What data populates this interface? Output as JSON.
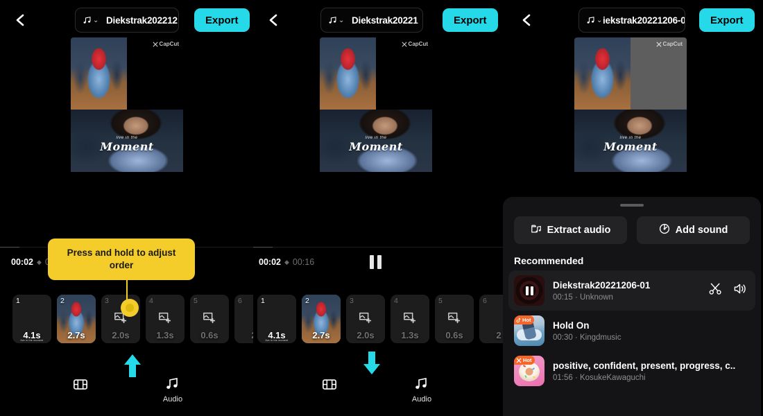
{
  "panes": [
    {
      "back_icon": "chevron-left-icon",
      "title": "Diekstrak202212",
      "music_icon": "music-note-icon",
      "export_label": "Export",
      "watermark": "CapCut",
      "overlay_text_small": "live in the",
      "overlay_text_big": "Moment",
      "time_current": "00:02",
      "time_total": "0",
      "nav": [
        {
          "label": "",
          "icon": "film-strip-icon",
          "selected": true
        },
        {
          "label": "Audio",
          "icon": "music-notes-icon",
          "selected": false
        }
      ],
      "clips": [
        {
          "num": "1",
          "duration": "4.1s",
          "kind": "thumb-girl",
          "selected": false,
          "caption": "live in the moment"
        },
        {
          "num": "2",
          "duration": "2.7s",
          "kind": "thumb-dance",
          "selected": true,
          "caption": ""
        },
        {
          "num": "3",
          "duration": "2.0s",
          "kind": "empty",
          "selected": false,
          "caption": ""
        },
        {
          "num": "4",
          "duration": "1.3s",
          "kind": "empty",
          "selected": false,
          "caption": ""
        },
        {
          "num": "5",
          "duration": "0.6s",
          "kind": "empty",
          "selected": false,
          "caption": ""
        },
        {
          "num": "6",
          "duration": "2",
          "kind": "empty",
          "selected": false,
          "caption": ""
        }
      ]
    },
    {
      "back_icon": "chevron-left-icon",
      "title": "Diekstrak20221",
      "music_icon": "music-note-icon",
      "export_label": "Export",
      "watermark": "CapCut",
      "overlay_text_small": "live in the",
      "overlay_text_big": "Moment",
      "time_current": "00:02",
      "time_total": "00:16",
      "pause_icon": "pause-icon",
      "nav": [
        {
          "label": "",
          "icon": "film-strip-icon",
          "selected": true
        },
        {
          "label": "Audio",
          "icon": "music-notes-icon",
          "selected": false
        }
      ],
      "clips": [
        {
          "num": "1",
          "duration": "4.1s",
          "kind": "thumb-girl",
          "selected": false,
          "caption": "live in the moment"
        },
        {
          "num": "2",
          "duration": "2.7s",
          "kind": "thumb-dance",
          "selected": true,
          "caption": ""
        },
        {
          "num": "3",
          "duration": "2.0s",
          "kind": "empty",
          "selected": false,
          "caption": ""
        },
        {
          "num": "4",
          "duration": "1.3s",
          "kind": "empty",
          "selected": false,
          "caption": ""
        },
        {
          "num": "5",
          "duration": "0.6s",
          "kind": "empty",
          "selected": false,
          "caption": ""
        },
        {
          "num": "6",
          "duration": "2",
          "kind": "empty",
          "selected": false,
          "caption": ""
        }
      ]
    },
    {
      "back_icon": "chevron-left-icon",
      "title": "iekstrak20221206-0",
      "music_icon": "music-note-icon",
      "export_label": "Export",
      "watermark": "CapCut",
      "overlay_text_small": "live in the",
      "overlay_text_big": "Moment"
    }
  ],
  "tooltip": {
    "text": "Press and hold to adjust order",
    "color": "#f5cd2b"
  },
  "arrows": {
    "color": "#26d9e8",
    "up": "arrow-up-icon",
    "down": "arrow-down-icon"
  },
  "audio_sheet": {
    "grabber": "drag-handle",
    "extract_audio_label": "Extract audio",
    "extract_audio_icon": "extract-audio-icon",
    "add_sound_label": "Add sound",
    "add_sound_icon": "add-sound-icon",
    "section_title": "Recommended",
    "sounds": [
      {
        "title": "Diekstrak20221206-01",
        "subtitle": "00:15 · Unknown",
        "art": "vinyl",
        "badge": "",
        "active": true,
        "ops": [
          "scissors-icon",
          "volume-icon"
        ]
      },
      {
        "title": "Hold On",
        "subtitle": "00:30 · Kingdmusic",
        "art": "hold",
        "badge": "Hot",
        "badge_icon": "tiktok-icon",
        "active": false,
        "ops": []
      },
      {
        "title": "positive, confident, present, progress, c..",
        "subtitle": "01:56 · KosukeKawaguchi",
        "art": "donut",
        "badge": "Hot",
        "badge_icon": "capcut-icon",
        "active": false,
        "ops": []
      }
    ]
  },
  "colors": {
    "accent": "#26d9e8",
    "tooltip": "#f5cd2b",
    "background": "#000000",
    "sheet": "#141416"
  }
}
